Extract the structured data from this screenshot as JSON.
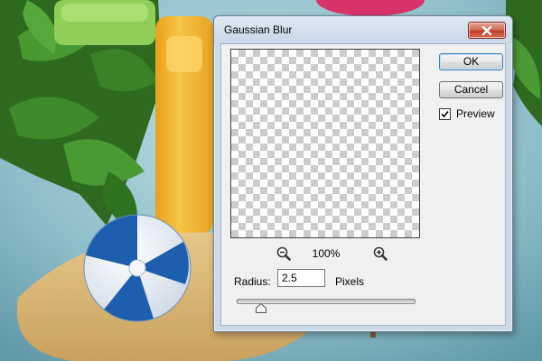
{
  "dialog": {
    "title": "Gaussian Blur",
    "close_icon": "close-icon"
  },
  "preview": {
    "zoom_out_icon": "zoom-out-icon",
    "zoom_level": "100%",
    "zoom_in_icon": "zoom-in-icon"
  },
  "radius": {
    "label": "Radius:",
    "value": "2.5",
    "unit": "Pixels",
    "slider_fraction": 0.13
  },
  "buttons": {
    "ok_label": "OK",
    "cancel_label": "Cancel"
  },
  "preview_toggle": {
    "label": "Preview",
    "checked": true
  },
  "colors": {
    "sky": "#9cc6cf",
    "sand": "#d9b675",
    "title_bar": "#cbd9e8",
    "close_button": "#c9462e",
    "ball_blue": "#1d5fae"
  }
}
